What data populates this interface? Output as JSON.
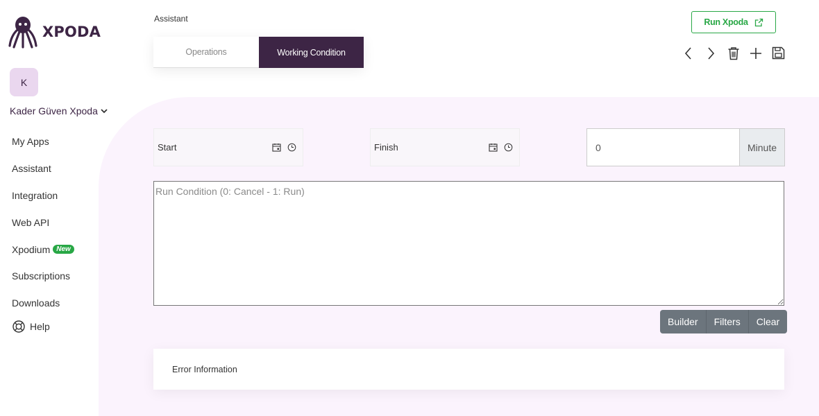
{
  "brand": {
    "name": "XPODA"
  },
  "user": {
    "initial": "K",
    "name": "Kader Güven Xpoda"
  },
  "nav": {
    "items": [
      {
        "label": "My Apps"
      },
      {
        "label": "Assistant"
      },
      {
        "label": "Integration"
      },
      {
        "label": "Web API"
      },
      {
        "label": "Xpodium",
        "badge": "New"
      },
      {
        "label": "Subscriptions"
      },
      {
        "label": "Downloads"
      }
    ],
    "help": "Help"
  },
  "breadcrumb": "Assistant",
  "tabs": [
    {
      "label": "Operations",
      "active": false
    },
    {
      "label": "Working Condition",
      "active": true
    }
  ],
  "header": {
    "run_button": "Run Xpoda"
  },
  "toolbar": {
    "icons": [
      "chevron-left-icon",
      "chevron-right-icon",
      "trash-icon",
      "plus-icon",
      "save-icon"
    ]
  },
  "form": {
    "start_label": "Start",
    "finish_label": "Finish",
    "minute_value": "0",
    "minute_unit": "Minute",
    "run_condition_placeholder": "Run Condition (0: Cancel - 1: Run)"
  },
  "actions": {
    "builder": "Builder",
    "filters": "Filters",
    "clear": "Clear"
  },
  "error_info": "Error Information",
  "colors": {
    "brand": "#3d2545",
    "accent_green": "#28a745",
    "content_bg": "#fbf3fd"
  }
}
